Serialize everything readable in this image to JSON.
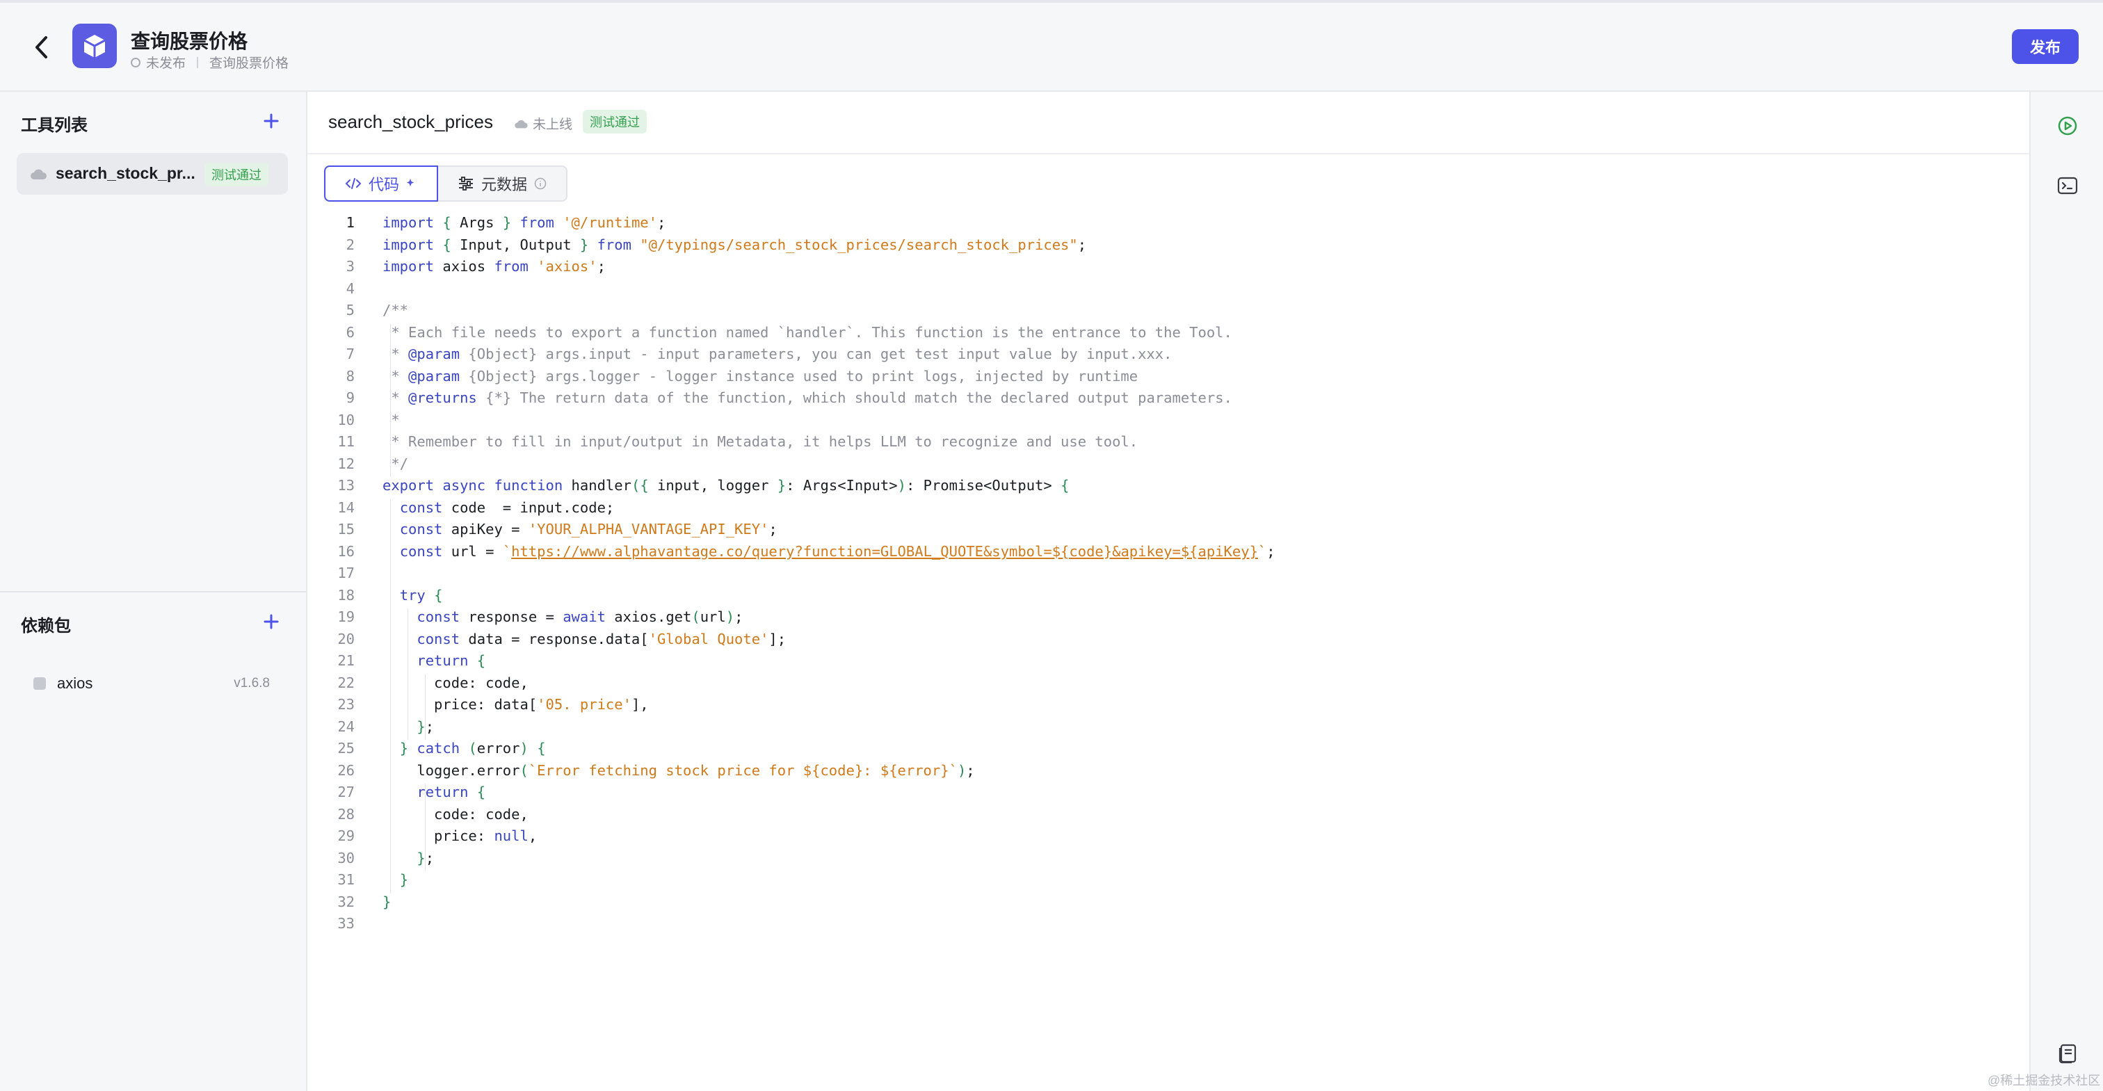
{
  "header": {
    "title": "查询股票价格",
    "status": "未发布",
    "breadcrumb": "查询股票价格",
    "publish_label": "发布"
  },
  "sidebar": {
    "tools_title": "工具列表",
    "tools": [
      {
        "name": "search_stock_pr...",
        "badge": "测试通过"
      }
    ],
    "deps_title": "依赖包",
    "deps": [
      {
        "name": "axios",
        "version": "v1.6.8"
      }
    ]
  },
  "main": {
    "function_name": "search_stock_prices",
    "status": "未上线",
    "badge": "测试通过",
    "tabs": [
      {
        "label": "代码"
      },
      {
        "label": "元数据"
      }
    ]
  },
  "code_lines": [
    "import { Args } from '@/runtime';",
    "import { Input, Output } from \"@/typings/search_stock_prices/search_stock_prices\";",
    "import axios from 'axios';",
    "",
    "/**",
    " * Each file needs to export a function named `handler`. This function is the entrance to the Tool.",
    " * @param {Object} args.input - input parameters, you can get test input value by input.xxx.",
    " * @param {Object} args.logger - logger instance used to print logs, injected by runtime",
    " * @returns {*} The return data of the function, which should match the declared output parameters.",
    " *",
    " * Remember to fill in input/output in Metadata, it helps LLM to recognize and use tool.",
    " */",
    "export async function handler({ input, logger }: Args<Input>): Promise<Output> {",
    "  const code  = input.code;",
    "  const apiKey = 'YOUR_ALPHA_VANTAGE_API_KEY';",
    "  const url = `https://www.alphavantage.co/query?function=GLOBAL_QUOTE&symbol=${code}&apikey=${apiKey}`;",
    "",
    "  try {",
    "    const response = await axios.get(url);",
    "    const data = response.data['Global Quote'];",
    "    return {",
    "      code: code,",
    "      price: data['05. price'],",
    "    };",
    "  } catch (error) {",
    "    logger.error(`Error fetching stock price for ${code}: ${error}`);",
    "    return {",
    "      code: code,",
    "      price: null,",
    "    };",
    "  }",
    "}",
    ""
  ],
  "watermark": "@稀土掘金技术社区",
  "colors": {
    "accent": "#4d53e8",
    "success_bg": "#e3f4e6",
    "success_text": "#33a04d"
  }
}
